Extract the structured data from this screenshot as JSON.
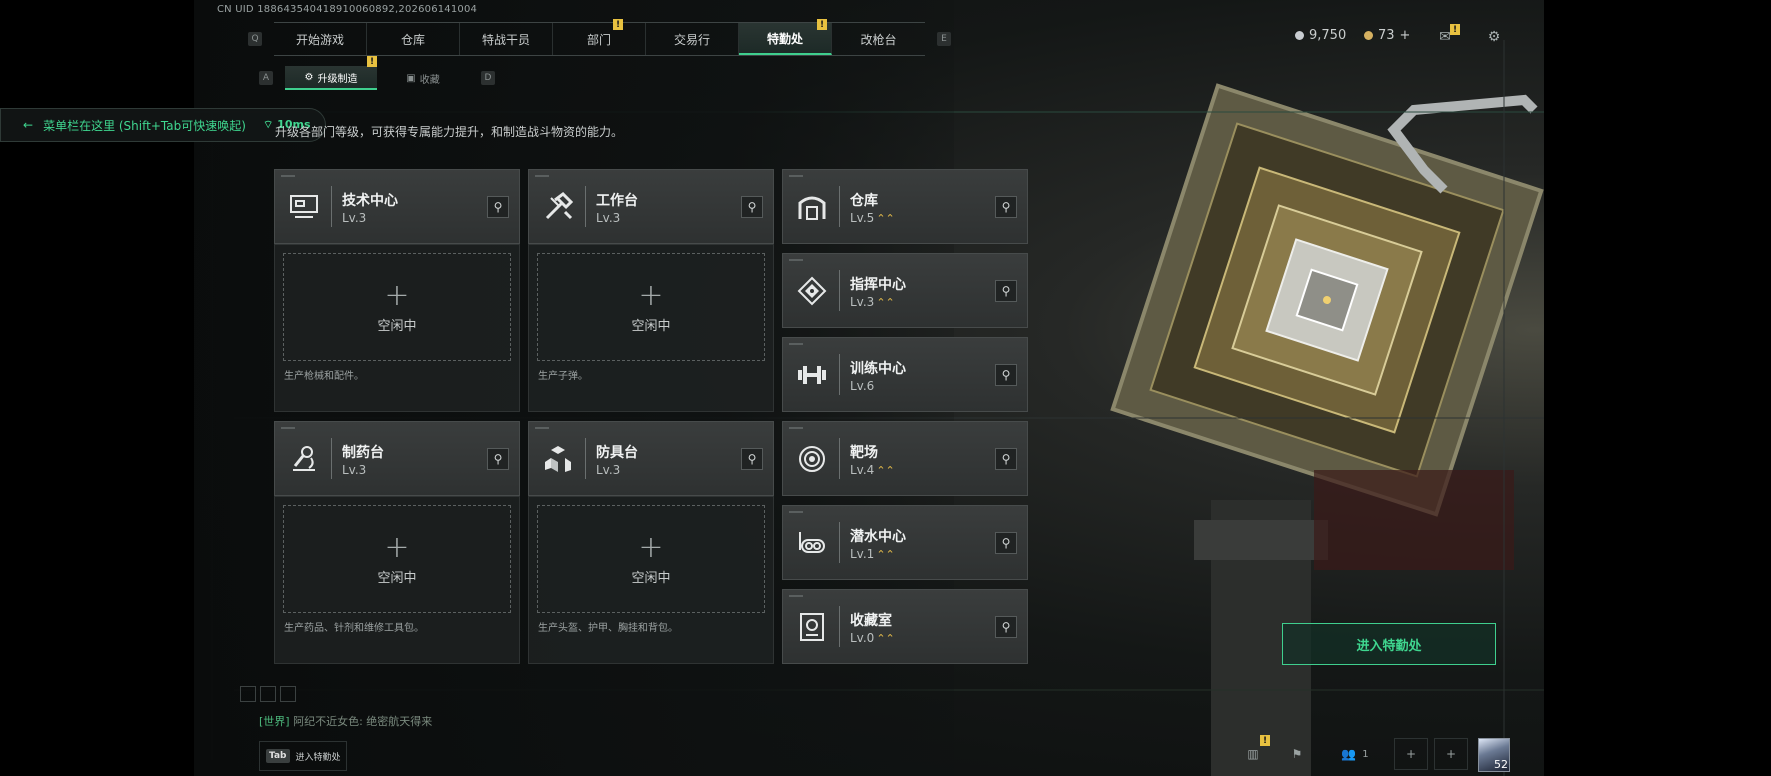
{
  "uid_text": "CN UID 18864354041891006089​2,202606141004",
  "nav": {
    "left_key": "Q",
    "right_key": "E",
    "tabs": [
      {
        "label": "开始游戏"
      },
      {
        "label": "仓库"
      },
      {
        "label": "特战干员"
      },
      {
        "label": "部门",
        "badge": "!"
      },
      {
        "label": "交易行"
      },
      {
        "label": "特勤处",
        "badge": "!",
        "active": true
      },
      {
        "label": "改枪台"
      }
    ]
  },
  "subnav": {
    "left_key": "A",
    "right_key": "D",
    "tabs": [
      {
        "label": "升级制造",
        "badge": "!",
        "active": true
      },
      {
        "label": "收藏"
      }
    ]
  },
  "currency": {
    "silver": "9,750",
    "gold": "73",
    "gold_add": "+",
    "mail_badge": "!"
  },
  "notice": {
    "text": "菜单栏在这里 (Shift+Tab可快速唤起)",
    "ping": "10ms"
  },
  "description": "升级各部门等级，可获得专属能力提升，和制造战斗物资的能力。",
  "production": [
    {
      "name": "技术中心",
      "level": "Lv.3",
      "icon": "tech-center-icon",
      "idle_label": "空闲中",
      "caption": "生产枪械和配件。"
    },
    {
      "name": "工作台",
      "level": "Lv.3",
      "icon": "workbench-icon",
      "idle_label": "空闲中",
      "caption": "生产子弹。"
    },
    {
      "name": "制药台",
      "level": "Lv.3",
      "icon": "pharmacy-icon",
      "idle_label": "空闲中",
      "caption": "生产药品、针剂和维修工具包。"
    },
    {
      "name": "防具台",
      "level": "Lv.3",
      "icon": "armor-bench-icon",
      "idle_label": "空闲中",
      "caption": "生产头盔、护甲、胸挂和背包。"
    }
  ],
  "facilities": [
    {
      "name": "仓库",
      "level": "Lv.5",
      "upgradable": true,
      "icon": "warehouse-icon"
    },
    {
      "name": "指挥中心",
      "level": "Lv.3",
      "upgradable": true,
      "icon": "command-center-icon"
    },
    {
      "name": "训练中心",
      "level": "Lv.6",
      "upgradable": false,
      "icon": "training-center-icon"
    },
    {
      "name": "靶场",
      "level": "Lv.4",
      "upgradable": true,
      "icon": "shooting-range-icon"
    },
    {
      "name": "潜水中心",
      "level": "Lv.1",
      "upgradable": true,
      "icon": "diving-center-icon"
    },
    {
      "name": "收藏室",
      "level": "Lv.0",
      "upgradable": true,
      "icon": "collection-room-icon"
    }
  ],
  "enter_button": "进入特勤处",
  "chat": {
    "channel": "[世界]",
    "message": "阿纪不近女色: 绝密航天得来"
  },
  "tab_hint": {
    "key": "Tab",
    "label": "进入特勤处"
  },
  "bottom": {
    "stats_badge": "!",
    "friends_count": "1",
    "player_level": "52"
  },
  "colors": {
    "accent_green": "#3fcf8e",
    "badge_yellow": "#e8c140",
    "upgrade_gold": "#e0b84a"
  }
}
